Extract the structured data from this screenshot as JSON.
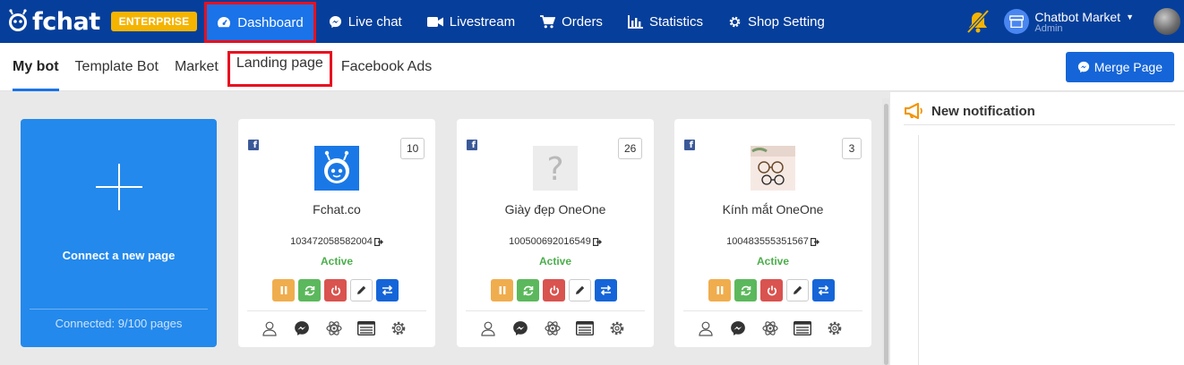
{
  "app": {
    "logo": "fchat",
    "plan_badge": "ENTERPRISE"
  },
  "nav": [
    {
      "label": "Dashboard",
      "icon": "gauge-icon",
      "active": true
    },
    {
      "label": "Live chat",
      "icon": "messenger-icon"
    },
    {
      "label": "Livestream",
      "icon": "video-camera-icon"
    },
    {
      "label": "Orders",
      "icon": "cart-icon"
    },
    {
      "label": "Statistics",
      "icon": "bar-chart-icon"
    },
    {
      "label": "Shop Setting",
      "icon": "gear-icon"
    }
  ],
  "user": {
    "name": "Chatbot Market",
    "role": "Admin"
  },
  "subnav": {
    "tabs": [
      {
        "label": "My bot",
        "active": true
      },
      {
        "label": "Template Bot"
      },
      {
        "label": "Market"
      },
      {
        "label": "Landing page",
        "highlighted": true
      },
      {
        "label": "Facebook Ads"
      }
    ],
    "merge_label": "Merge Page"
  },
  "connect": {
    "label": "Connect a new page",
    "count_label": "Connected: 9/100 pages"
  },
  "bots": [
    {
      "name": "Fchat.co",
      "page_id": "103472058582004",
      "status": "Active",
      "count": "10",
      "avatar": "robot"
    },
    {
      "name": "Giày đẹp OneOne",
      "page_id": "100500692016549",
      "status": "Active",
      "count": "26",
      "avatar": "placeholder"
    },
    {
      "name": "Kính mắt OneOne",
      "page_id": "100483555351567",
      "status": "Active",
      "count": "3",
      "avatar": "glasses"
    }
  ],
  "notifications": {
    "title": "New notification"
  },
  "colors": {
    "topbar": "#063f9b",
    "accent": "#1a73e8",
    "highlight_border": "#e8101f",
    "connect_card": "#2389ec",
    "status_active": "#4cae4c",
    "enterprise": "#f5b400"
  }
}
